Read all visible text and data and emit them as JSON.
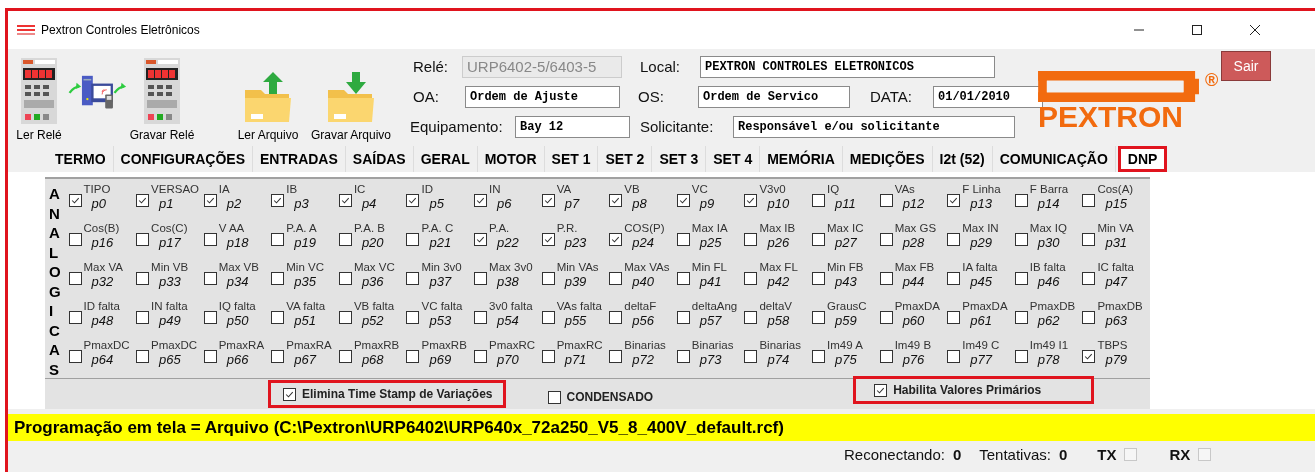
{
  "window": {
    "title": "Pextron Controles Eletrônicos"
  },
  "tools": [
    {
      "label": "Ler Relé",
      "kind": "relay"
    },
    {
      "label": "Gravar Relé",
      "kind": "relay"
    },
    {
      "label": "Ler Arquivo",
      "kind": "folder-up"
    },
    {
      "label": "Gravar Arquivo",
      "kind": "folder-down"
    }
  ],
  "field_rows": [
    [
      {
        "label": "Relé:",
        "value": "URP6402-5/6403-5",
        "disabled": true
      },
      {
        "label": "Local:",
        "value": "PEXTRON CONTROLES ELETRONICOS",
        "disabled": false
      }
    ],
    [
      {
        "label": "OA:",
        "value": "Ordem de Ajuste",
        "disabled": false
      },
      {
        "label": "OS:",
        "value": "Ordem de Servico",
        "disabled": false
      },
      {
        "label": "DATA:",
        "value": "01/01/2010",
        "disabled": false
      }
    ],
    [
      {
        "label": "Equipamento:",
        "value": "Bay 12",
        "disabled": false
      },
      {
        "label": "Solicitante:",
        "value": "Responsável e/ou solicitante",
        "disabled": false
      }
    ]
  ],
  "logo": {
    "text": "PEXTRON",
    "mark": "®"
  },
  "exit_button": "Sair",
  "tabs": [
    {
      "label": "TERMO",
      "selected": false,
      "highlighted": false
    },
    {
      "label": "CONFIGURAÇÕES",
      "selected": false,
      "highlighted": false
    },
    {
      "label": "ENTRADAS",
      "selected": false,
      "highlighted": false
    },
    {
      "label": "SAÍDAS",
      "selected": false,
      "highlighted": false
    },
    {
      "label": "GERAL",
      "selected": false,
      "highlighted": false
    },
    {
      "label": "MOTOR",
      "selected": false,
      "highlighted": false
    },
    {
      "label": "SET 1",
      "selected": false,
      "highlighted": false
    },
    {
      "label": "SET 2",
      "selected": false,
      "highlighted": false
    },
    {
      "label": "SET 3",
      "selected": false,
      "highlighted": false
    },
    {
      "label": "SET 4",
      "selected": false,
      "highlighted": false
    },
    {
      "label": "MEMÓRIA",
      "selected": false,
      "highlighted": false
    },
    {
      "label": "MEDIÇÕES",
      "selected": false,
      "highlighted": false
    },
    {
      "label": "I2t (52)",
      "selected": false,
      "highlighted": false
    },
    {
      "label": "COMUNICAÇÃO",
      "selected": false,
      "highlighted": false
    },
    {
      "label": "DNP",
      "selected": true,
      "highlighted": true
    }
  ],
  "analog_panel": {
    "side_label": "ANALOGICAS",
    "points": [
      {
        "label": "TIPO",
        "code": "p0",
        "checked": true
      },
      {
        "label": "VERSAO",
        "code": "p1",
        "checked": true
      },
      {
        "label": "IA",
        "code": "p2",
        "checked": true
      },
      {
        "label": "IB",
        "code": "p3",
        "checked": true
      },
      {
        "label": "IC",
        "code": "p4",
        "checked": true
      },
      {
        "label": "ID",
        "code": "p5",
        "checked": true
      },
      {
        "label": "IN",
        "code": "p6",
        "checked": true
      },
      {
        "label": "VA",
        "code": "p7",
        "checked": true
      },
      {
        "label": "VB",
        "code": "p8",
        "checked": true
      },
      {
        "label": "VC",
        "code": "p9",
        "checked": true
      },
      {
        "label": "V3v0",
        "code": "p10",
        "checked": true
      },
      {
        "label": "IQ",
        "code": "p11",
        "checked": false
      },
      {
        "label": "VAs",
        "code": "p12",
        "checked": false
      },
      {
        "label": "F Linha",
        "code": "p13",
        "checked": true
      },
      {
        "label": "F Barra",
        "code": "p14",
        "checked": false
      },
      {
        "label": "Cos(A)",
        "code": "p15",
        "checked": false
      },
      {
        "label": "Cos(B)",
        "code": "p16",
        "checked": false
      },
      {
        "label": "Cos(C)",
        "code": "p17",
        "checked": false
      },
      {
        "label": "V AA",
        "code": "p18",
        "checked": false
      },
      {
        "label": "P.A. A",
        "code": "p19",
        "checked": false
      },
      {
        "label": "P.A. B",
        "code": "p20",
        "checked": false
      },
      {
        "label": "P.A. C",
        "code": "p21",
        "checked": false
      },
      {
        "label": "P.A.",
        "code": "p22",
        "checked": true
      },
      {
        "label": "P.R.",
        "code": "p23",
        "checked": true
      },
      {
        "label": "COS(P)",
        "code": "p24",
        "checked": true
      },
      {
        "label": "Max IA",
        "code": "p25",
        "checked": false
      },
      {
        "label": "Max IB",
        "code": "p26",
        "checked": false
      },
      {
        "label": "Max IC",
        "code": "p27",
        "checked": false
      },
      {
        "label": "Max GS",
        "code": "p28",
        "checked": false
      },
      {
        "label": "Max IN",
        "code": "p29",
        "checked": false
      },
      {
        "label": "Max IQ",
        "code": "p30",
        "checked": false
      },
      {
        "label": "Min VA",
        "code": "p31",
        "checked": false
      },
      {
        "label": "Max VA",
        "code": "p32",
        "checked": false
      },
      {
        "label": "Min VB",
        "code": "p33",
        "checked": false
      },
      {
        "label": "Max VB",
        "code": "p34",
        "checked": false
      },
      {
        "label": "Min VC",
        "code": "p35",
        "checked": false
      },
      {
        "label": "Max VC",
        "code": "p36",
        "checked": false
      },
      {
        "label": "Min 3v0",
        "code": "p37",
        "checked": false
      },
      {
        "label": "Max 3v0",
        "code": "p38",
        "checked": false
      },
      {
        "label": "Min VAs",
        "code": "p39",
        "checked": false
      },
      {
        "label": "Max VAs",
        "code": "p40",
        "checked": false
      },
      {
        "label": "Min FL",
        "code": "p41",
        "checked": false
      },
      {
        "label": "Max FL",
        "code": "p42",
        "checked": false
      },
      {
        "label": "Min FB",
        "code": "p43",
        "checked": false
      },
      {
        "label": "Max FB",
        "code": "p44",
        "checked": false
      },
      {
        "label": "IA falta",
        "code": "p45",
        "checked": false
      },
      {
        "label": "IB falta",
        "code": "p46",
        "checked": false
      },
      {
        "label": "IC falta",
        "code": "p47",
        "checked": false
      },
      {
        "label": "ID falta",
        "code": "p48",
        "checked": false
      },
      {
        "label": "IN falta",
        "code": "p49",
        "checked": false
      },
      {
        "label": "IQ falta",
        "code": "p50",
        "checked": false
      },
      {
        "label": "VA falta",
        "code": "p51",
        "checked": false
      },
      {
        "label": "VB falta",
        "code": "p52",
        "checked": false
      },
      {
        "label": "VC falta",
        "code": "p53",
        "checked": false
      },
      {
        "label": "3v0 falta",
        "code": "p54",
        "checked": false
      },
      {
        "label": "VAs falta",
        "code": "p55",
        "checked": false
      },
      {
        "label": "deltaF",
        "code": "p56",
        "checked": false
      },
      {
        "label": "deltaAng",
        "code": "p57",
        "checked": false
      },
      {
        "label": "deltaV",
        "code": "p58",
        "checked": false
      },
      {
        "label": "GrausC",
        "code": "p59",
        "checked": false
      },
      {
        "label": "PmaxDA",
        "code": "p60",
        "checked": false
      },
      {
        "label": "PmaxDA",
        "code": "p61",
        "checked": false
      },
      {
        "label": "PmaxDB",
        "code": "p62",
        "checked": false
      },
      {
        "label": "PmaxDB",
        "code": "p63",
        "checked": false
      },
      {
        "label": "PmaxDC",
        "code": "p64",
        "checked": false
      },
      {
        "label": "PmaxDC",
        "code": "p65",
        "checked": false
      },
      {
        "label": "PmaxRA",
        "code": "p66",
        "checked": false
      },
      {
        "label": "PmaxRA",
        "code": "p67",
        "checked": false
      },
      {
        "label": "PmaxRB",
        "code": "p68",
        "checked": false
      },
      {
        "label": "PmaxRB",
        "code": "p69",
        "checked": false
      },
      {
        "label": "PmaxRC",
        "code": "p70",
        "checked": false
      },
      {
        "label": "PmaxRC",
        "code": "p71",
        "checked": false
      },
      {
        "label": "Binarias",
        "code": "p72",
        "checked": false
      },
      {
        "label": "Binarias",
        "code": "p73",
        "checked": false
      },
      {
        "label": "Binarias",
        "code": "p74",
        "checked": false
      },
      {
        "label": "Im49 A",
        "code": "p75",
        "checked": false
      },
      {
        "label": "Im49 B",
        "code": "p76",
        "checked": false
      },
      {
        "label": "Im49 C",
        "code": "p77",
        "checked": false
      },
      {
        "label": "Im49 I1",
        "code": "p78",
        "checked": false
      },
      {
        "label": "TBPS",
        "code": "p79",
        "checked": true
      }
    ]
  },
  "options": [
    {
      "label": "Elimina Time Stamp de Variações",
      "checked": true,
      "highlighted": true
    },
    {
      "label": "CONDENSADO",
      "checked": false,
      "highlighted": false
    },
    {
      "label": "Habilita Valores Primários",
      "checked": true,
      "highlighted": true
    }
  ],
  "program_line": "Programação em tela = Arquivo (C:\\Pextron\\URP6402\\URP640x_72a250_V5_8_400V_default.rcf)",
  "status_bar": {
    "items": [
      {
        "label": "Reconectando:",
        "value": "0"
      },
      {
        "label": "Tentativas:",
        "value": "0"
      }
    ],
    "indicators": [
      {
        "label": "TX",
        "on": false
      },
      {
        "label": "RX",
        "on": false
      }
    ]
  }
}
